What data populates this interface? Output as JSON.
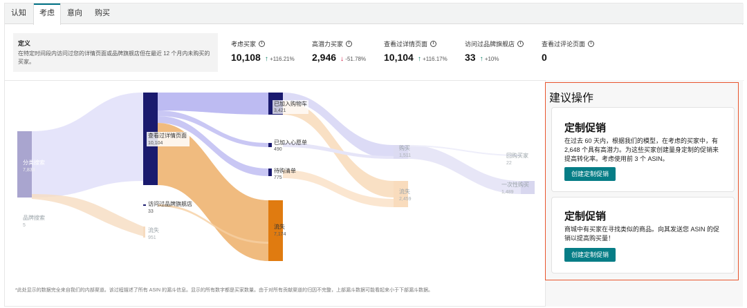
{
  "tabs": [
    {
      "label": "认知",
      "active": false
    },
    {
      "label": "考虑",
      "active": true
    },
    {
      "label": "意向",
      "active": false
    },
    {
      "label": "购买",
      "active": false
    }
  ],
  "definition": {
    "title": "定义",
    "text": "在特定时间段内访问过您的详情页面或品牌旗舰店但在最近 12 个月内未购买的买家。"
  },
  "metrics": [
    {
      "label": "考虑买家",
      "value": "10,108",
      "change": "+116.21%",
      "direction": "up"
    },
    {
      "label": "高潜力买家",
      "value": "2,946",
      "change": "-51.78%",
      "direction": "down"
    },
    {
      "label": "查看过详情页面",
      "value": "10,104",
      "change": "+116.17%",
      "direction": "up"
    },
    {
      "label": "访问过品牌旗舰店",
      "value": "33",
      "change": "+10%",
      "direction": "up"
    },
    {
      "label": "查看过评论页面",
      "value": "0",
      "change": "",
      "direction": ""
    }
  ],
  "sankey": {
    "nodes": {
      "category_search": {
        "label": "分类搜索",
        "value": "7,833"
      },
      "brand_search": {
        "label": "品牌搜索",
        "value": "5"
      },
      "detail_page": {
        "label": "查看过详情页面",
        "value": "10,104"
      },
      "store": {
        "label": "访问过品牌旗舰店",
        "value": "33"
      },
      "churn_left": {
        "label": "流失",
        "value": "951"
      },
      "cart": {
        "label": "已加入购物车",
        "value": "3,421"
      },
      "wishlist": {
        "label": "已加入心愿单",
        "value": "490"
      },
      "registry": {
        "label": "待购清单",
        "value": "775"
      },
      "churn_mid": {
        "label": "流失",
        "value": "7,174"
      },
      "purchase": {
        "label": "购买",
        "value": "1,511"
      },
      "churn_right": {
        "label": "流失",
        "value": "2,459"
      },
      "repeat": {
        "label": "回购买家",
        "value": "22"
      },
      "one_time": {
        "label": "一次性购买",
        "value": "1,489"
      }
    },
    "colors": {
      "navy": "#1a1a6e",
      "lavender": "#b9b7f0",
      "orange": "#e88f2c",
      "peach": "#f3c08a",
      "grey_node": "#a9a5cf"
    }
  },
  "footnote": "*此处显示的数据完全来自我们的内部渠道。该过程描述了所有 ASIN 的漏斗信息。显示的所有数字都是买家数量。由于对所有贡献渠道的归因不完整，上部漏斗数据可能看起来小于下部漏斗数据。",
  "recommendations": {
    "title": "建议操作",
    "cards": [
      {
        "title": "定制促销",
        "body": "在过去 60 天内，根据我们的模型，在考虑的买家中，有 2,648 个具有高潜力。为这些买家创建量身定制的促销来提高转化率。考虑使用前 3 个 ASIN。",
        "button": "创建定制促销"
      },
      {
        "title": "定制促销",
        "body": "商城中有买家在寻找类似的商品。向其发送您 ASIN 的促销以提高购买量！",
        "button": "创建定制促销"
      }
    ]
  }
}
